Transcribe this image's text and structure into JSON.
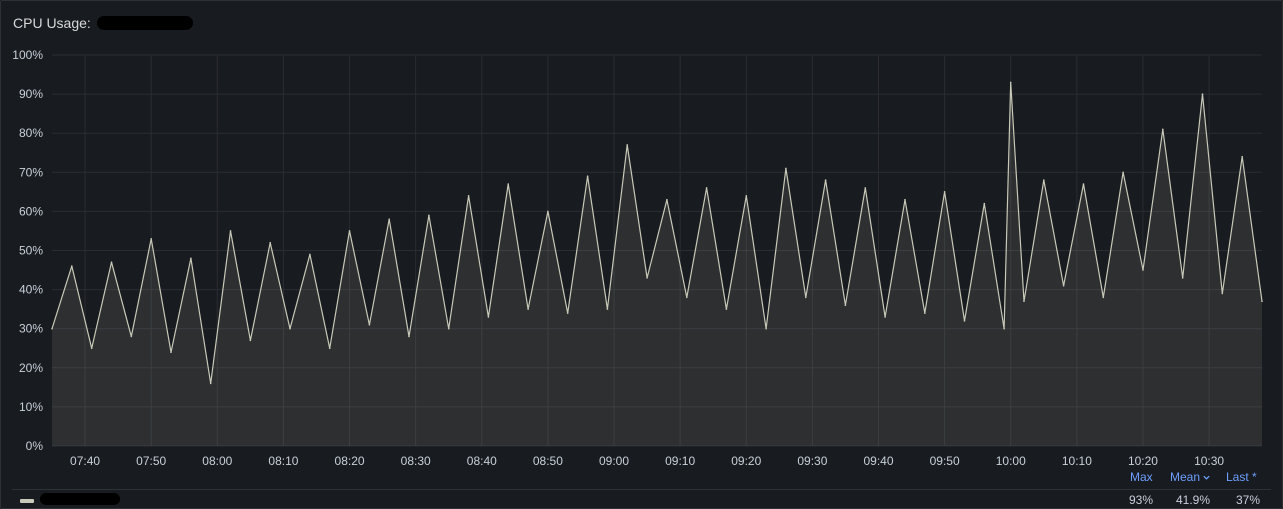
{
  "panel": {
    "title_prefix": "CPU Usage:"
  },
  "legend": {
    "headers": {
      "max": "Max",
      "mean": "Mean",
      "last": "Last"
    },
    "mean_sort_icon": "chevron-down-icon",
    "last_marker": "*",
    "values": {
      "max": "93%",
      "mean": "41.9%",
      "last": "37%"
    },
    "series_color": "#c8c9b8"
  },
  "chart_data": {
    "type": "area",
    "ylim": [
      0,
      100
    ],
    "y_ticks": [
      "0%",
      "10%",
      "20%",
      "30%",
      "40%",
      "50%",
      "60%",
      "70%",
      "80%",
      "90%",
      "100%"
    ],
    "x_ticks": [
      "07:40",
      "07:50",
      "08:00",
      "08:10",
      "08:20",
      "08:30",
      "08:40",
      "08:50",
      "09:00",
      "09:10",
      "09:20",
      "09:30",
      "09:40",
      "09:50",
      "10:00",
      "10:10",
      "10:20",
      "10:30"
    ],
    "x_range": [
      "07:35",
      "10:38"
    ],
    "grid": true,
    "series": [
      {
        "x": [
          "07:35",
          "07:38",
          "07:41",
          "07:44",
          "07:47",
          "07:50",
          "07:53",
          "07:56",
          "07:59",
          "08:02",
          "08:05",
          "08:08",
          "08:11",
          "08:14",
          "08:17",
          "08:20",
          "08:23",
          "08:26",
          "08:29",
          "08:32",
          "08:35",
          "08:38",
          "08:41",
          "08:44",
          "08:47",
          "08:50",
          "08:53",
          "08:56",
          "08:59",
          "09:02",
          "09:05",
          "09:08",
          "09:11",
          "09:14",
          "09:17",
          "09:20",
          "09:23",
          "09:26",
          "09:29",
          "09:32",
          "09:35",
          "09:38",
          "09:41",
          "09:44",
          "09:47",
          "09:50",
          "09:53",
          "09:56",
          "09:59",
          "10:00",
          "10:02",
          "10:05",
          "10:08",
          "10:11",
          "10:14",
          "10:17",
          "10:20",
          "10:23",
          "10:26",
          "10:29",
          "10:32",
          "10:35",
          "10:38"
        ],
        "values": [
          30,
          46,
          25,
          47,
          28,
          53,
          24,
          48,
          16,
          55,
          27,
          52,
          30,
          49,
          25,
          55,
          31,
          58,
          28,
          59,
          30,
          64,
          33,
          67,
          35,
          60,
          34,
          69,
          35,
          77,
          43,
          63,
          38,
          66,
          35,
          64,
          30,
          71,
          38,
          68,
          36,
          66,
          33,
          63,
          34,
          65,
          32,
          62,
          30,
          93,
          37,
          68,
          41,
          67,
          38,
          70,
          45,
          81,
          43,
          90,
          39,
          74,
          37
        ]
      }
    ]
  }
}
